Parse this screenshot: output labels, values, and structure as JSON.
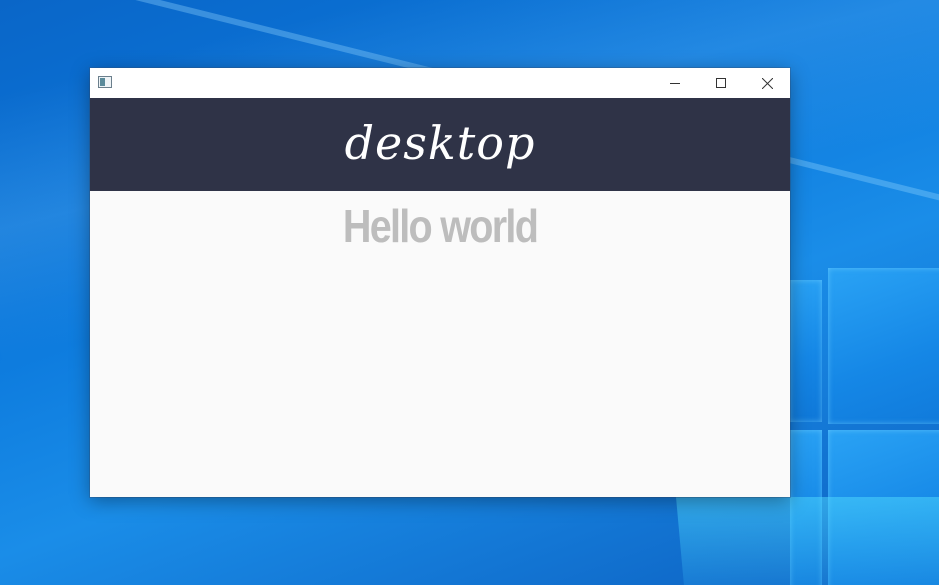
{
  "window": {
    "icon": "app-window-icon",
    "controls": [
      {
        "name": "minimize",
        "icon": "minimize-icon"
      },
      {
        "name": "maximize",
        "icon": "maximize-icon"
      },
      {
        "name": "close",
        "icon": "close-icon"
      }
    ]
  },
  "header": {
    "title": "desktop",
    "background": "#2f3347"
  },
  "content": {
    "greeting": "Hello world",
    "greeting_color": "#bdbdbd"
  }
}
